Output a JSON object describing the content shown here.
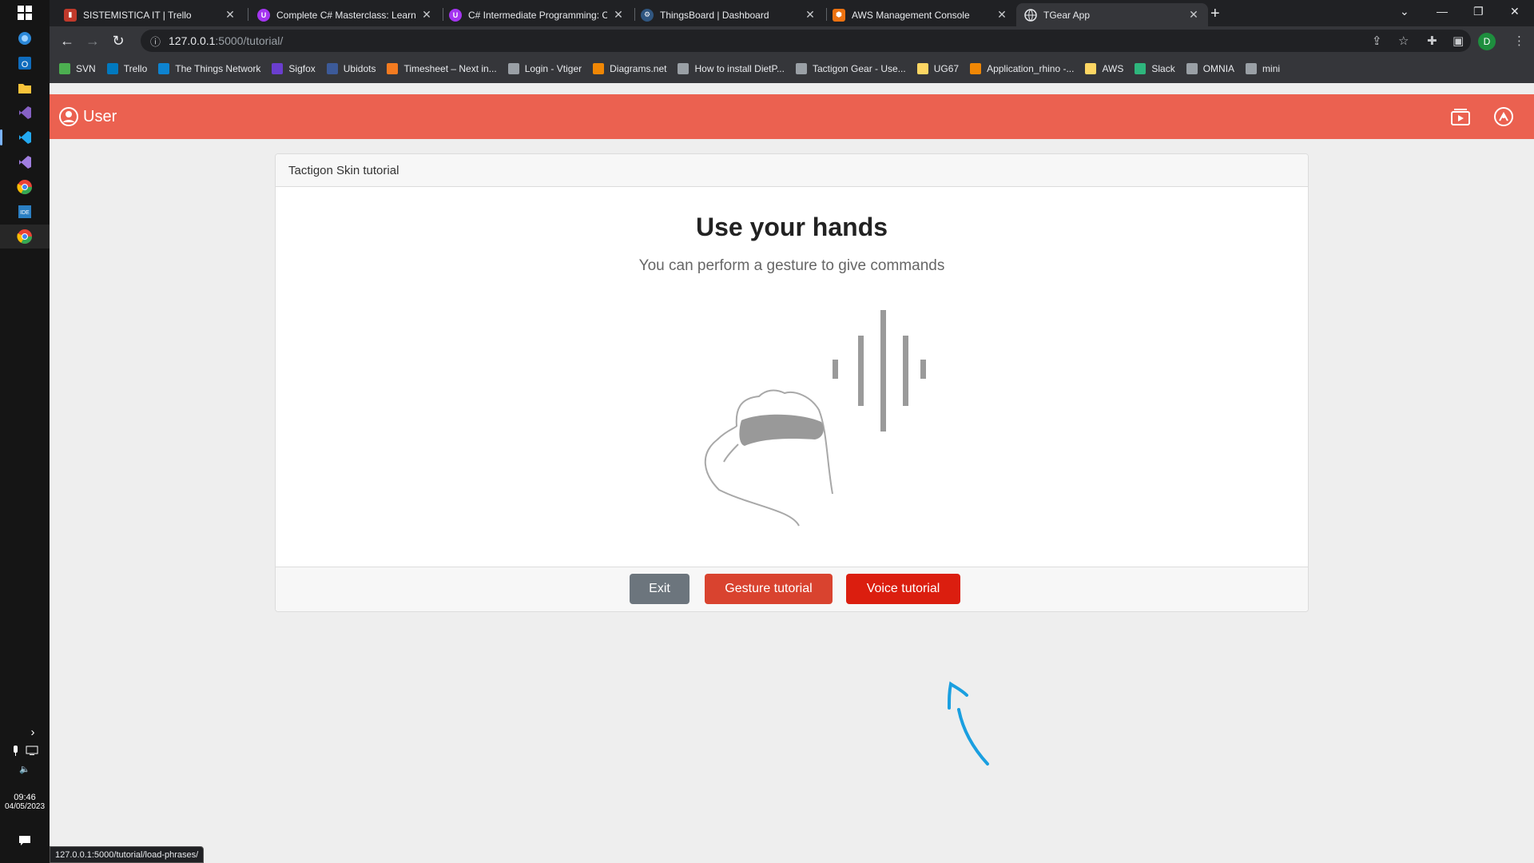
{
  "taskbar": {
    "time": "09:46",
    "date": "04/05/2023"
  },
  "tabs": [
    {
      "title": "SISTEMISTICA IT | Trello",
      "favicon_color": "#c0392b"
    },
    {
      "title": "Complete C# Masterclass: Learn t",
      "favicon_color": "#a435f0"
    },
    {
      "title": "C# Intermediate Programming: C",
      "favicon_color": "#a435f0"
    },
    {
      "title": "ThingsBoard | Dashboard",
      "favicon_color": "#305680"
    },
    {
      "title": "AWS Management Console",
      "favicon_color": "#ec7211"
    },
    {
      "title": "TGear App",
      "favicon_color": "#5f6368"
    }
  ],
  "address_bar": {
    "host": "127.0.0.1",
    "path": ":5000/tutorial/"
  },
  "profile_initial": "D",
  "bookmarks": [
    {
      "label": "SVN",
      "color": "#4caf50"
    },
    {
      "label": "Trello",
      "color": "#0079bf"
    },
    {
      "label": "The Things Network",
      "color": "#0d83d0"
    },
    {
      "label": "Sigfox",
      "color": "#6a3ecf"
    },
    {
      "label": "Ubidots",
      "color": "#3c5a99"
    },
    {
      "label": "Timesheet – Next in...",
      "color": "#f47b20"
    },
    {
      "label": "Login - Vtiger",
      "color": "#9aa0a6"
    },
    {
      "label": "Diagrams.net",
      "color": "#f08705"
    },
    {
      "label": "How to install DietP...",
      "color": "#9aa0a6"
    },
    {
      "label": "Tactigon Gear - Use...",
      "color": "#9aa0a6"
    },
    {
      "label": "UG67",
      "color": "#fdd663"
    },
    {
      "label": "Application_rhino -...",
      "color": "#f08705"
    },
    {
      "label": "AWS",
      "color": "#fdd663"
    },
    {
      "label": "Slack",
      "color": "#2eb67d"
    },
    {
      "label": "OMNIA",
      "color": "#9aa0a6"
    },
    {
      "label": "mini",
      "color": "#9aa0a6"
    }
  ],
  "app": {
    "user_label": "User",
    "header_color": "#eb6150",
    "card_title": "Tactigon Skin tutorial",
    "heading": "Use your hands",
    "subheading": "You can perform a gesture to give commands",
    "buttons": {
      "exit": "Exit",
      "gesture": "Gesture tutorial",
      "voice": "Voice tutorial"
    }
  },
  "status_url": "127.0.0.1:5000/tutorial/load-phrases/"
}
